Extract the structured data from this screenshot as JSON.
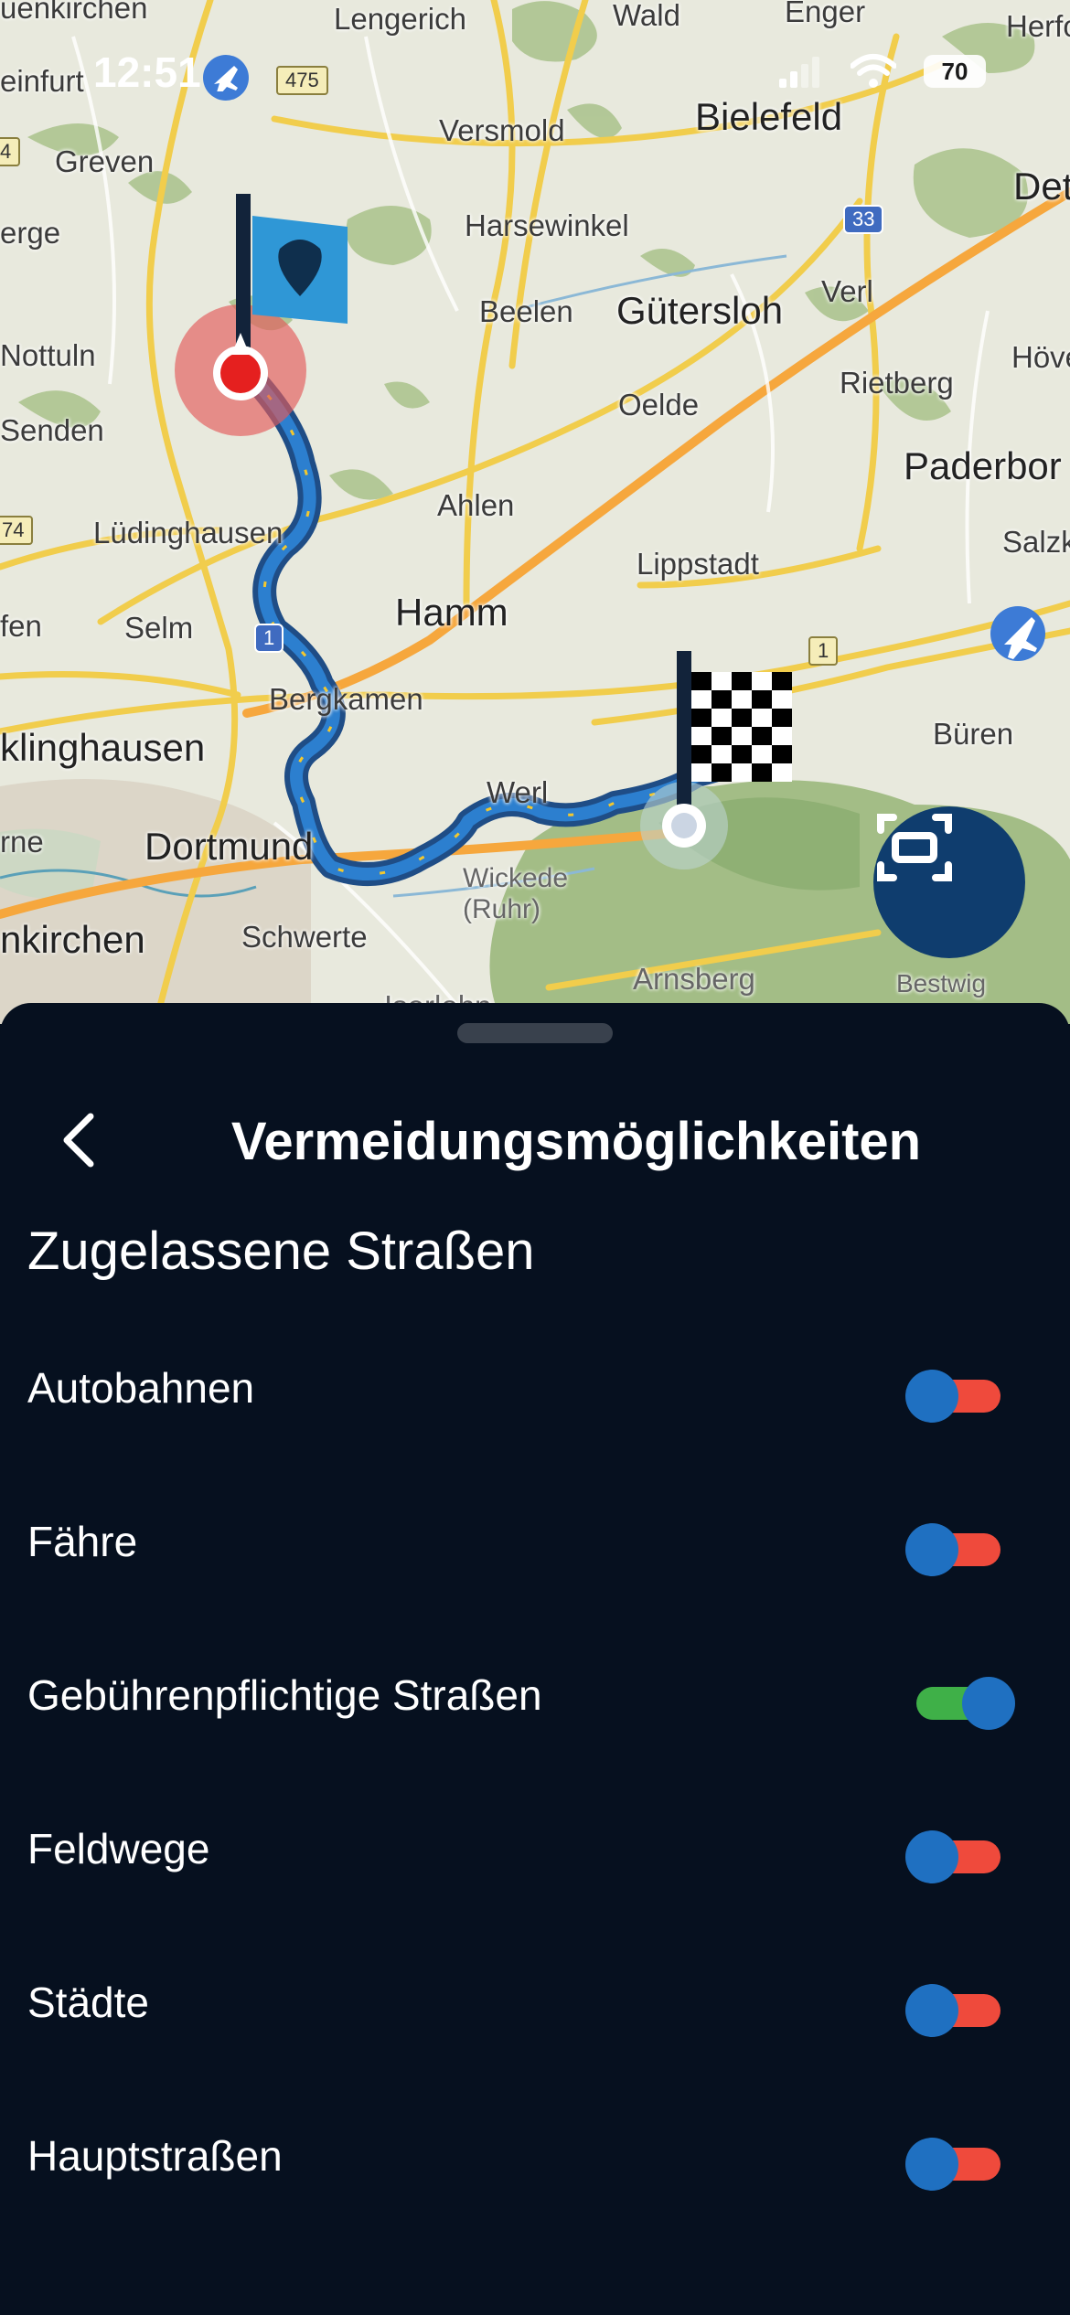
{
  "status_bar": {
    "time": "12:51",
    "battery": "70",
    "icons": [
      "airplane-mode-icon",
      "signal-icon",
      "wifi-icon",
      "battery-icon"
    ]
  },
  "map": {
    "places": [
      {
        "name": "uenkirchen"
      },
      {
        "name": "Lengerich"
      },
      {
        "name": "Wald"
      },
      {
        "name": "Enger"
      },
      {
        "name": "Herfor"
      },
      {
        "name": "einfurt"
      },
      {
        "name": "Greven"
      },
      {
        "name": "Versmold"
      },
      {
        "name": "Bielefeld"
      },
      {
        "name": "Det"
      },
      {
        "name": "Harsewinkel"
      },
      {
        "name": "erge"
      },
      {
        "name": "Beelen"
      },
      {
        "name": "Gütersloh"
      },
      {
        "name": "Verl"
      },
      {
        "name": "Nottuln"
      },
      {
        "name": "Hövel"
      },
      {
        "name": "Oelde"
      },
      {
        "name": "Rietberg"
      },
      {
        "name": "Senden"
      },
      {
        "name": "Paderbor"
      },
      {
        "name": "Ahlen"
      },
      {
        "name": "Lüdinghausen"
      },
      {
        "name": "Salzk"
      },
      {
        "name": "Lippstadt"
      },
      {
        "name": "Selm"
      },
      {
        "name": "Hamm"
      },
      {
        "name": "fen"
      },
      {
        "name": "Bergkamen"
      },
      {
        "name": "Büren"
      },
      {
        "name": "klinghausen"
      },
      {
        "name": "Werl"
      },
      {
        "name": "rne"
      },
      {
        "name": "Dortmund"
      },
      {
        "name": "Wickede (Ruhr)"
      },
      {
        "name": "nkirchen"
      },
      {
        "name": "Schwerte"
      },
      {
        "name": "Arnsberg"
      },
      {
        "name": "Bestwig"
      },
      {
        "name": "Iserlohn"
      }
    ],
    "road_shields": [
      "475",
      "33",
      "1",
      "1",
      "74",
      "4"
    ],
    "start_marker": "start-flag-icon",
    "end_marker": "finish-flag-icon",
    "recenter_icon": "fit-route-icon"
  },
  "sheet": {
    "back_icon": "chevron-left-icon",
    "title": "Vermeidungsmöglichkeiten",
    "section_title": "Zugelassene Straßen",
    "options": [
      {
        "label": "Autobahnen",
        "enabled": false
      },
      {
        "label": "Fähre",
        "enabled": false
      },
      {
        "label": "Gebührenpflichtige Straßen",
        "enabled": true
      },
      {
        "label": "Feldwege",
        "enabled": false
      },
      {
        "label": "Städte",
        "enabled": false
      },
      {
        "label": "Hauptstraßen",
        "enabled": false
      }
    ],
    "colors": {
      "background": "#06101f",
      "toggle_off_track": "#ef4a3c",
      "toggle_on_track": "#3fb048",
      "toggle_knob": "#1f70c1"
    }
  }
}
